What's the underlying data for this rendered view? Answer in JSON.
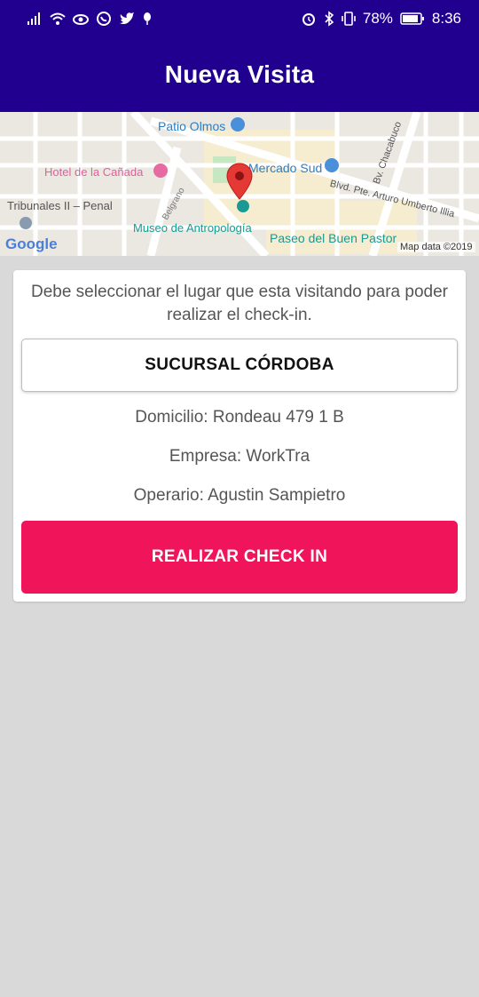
{
  "status_bar": {
    "battery": "78%",
    "time": "8:36",
    "icons": [
      "signal-icon",
      "wifi-icon",
      "eye-icon",
      "whatsapp-icon",
      "twitter-icon",
      "balloon-icon",
      "alarm-icon",
      "bluetooth-icon",
      "vibrate-icon",
      "battery-icon"
    ]
  },
  "header": {
    "title": "Nueva Visita"
  },
  "map": {
    "labels": {
      "patio_olmos": "Patio Olmos",
      "hotel": "Hotel de la Cañada",
      "mercado": "Mercado Sud",
      "bv_chacabuco": "Bv. Chacabuco",
      "blvd": "Blvd. Pte. Arturo Umberto Illia",
      "tribunales": "Tribunales II – Penal",
      "belgrano": "Belgrano",
      "museo": "Museo de Antropología",
      "paseo": "Paseo del Buen Pastor",
      "google": "Google",
      "map_data": "Map data ©2019"
    }
  },
  "card": {
    "instructions": "Debe seleccionar el lugar que esta visitando para poder realizar el check-in.",
    "branch_button": "SUCURSAL CÓRDOBA",
    "domicilio": "Domicilio: Rondeau 479 1 B",
    "empresa": "Empresa: WorkTra",
    "operario": "Operario: Agustin Sampietro",
    "checkin_button": "REALIZAR CHECK IN"
  },
  "colors": {
    "header_bg": "#21008f",
    "checkin_bg": "#f0145a",
    "page_bg": "#d9d9d9"
  }
}
